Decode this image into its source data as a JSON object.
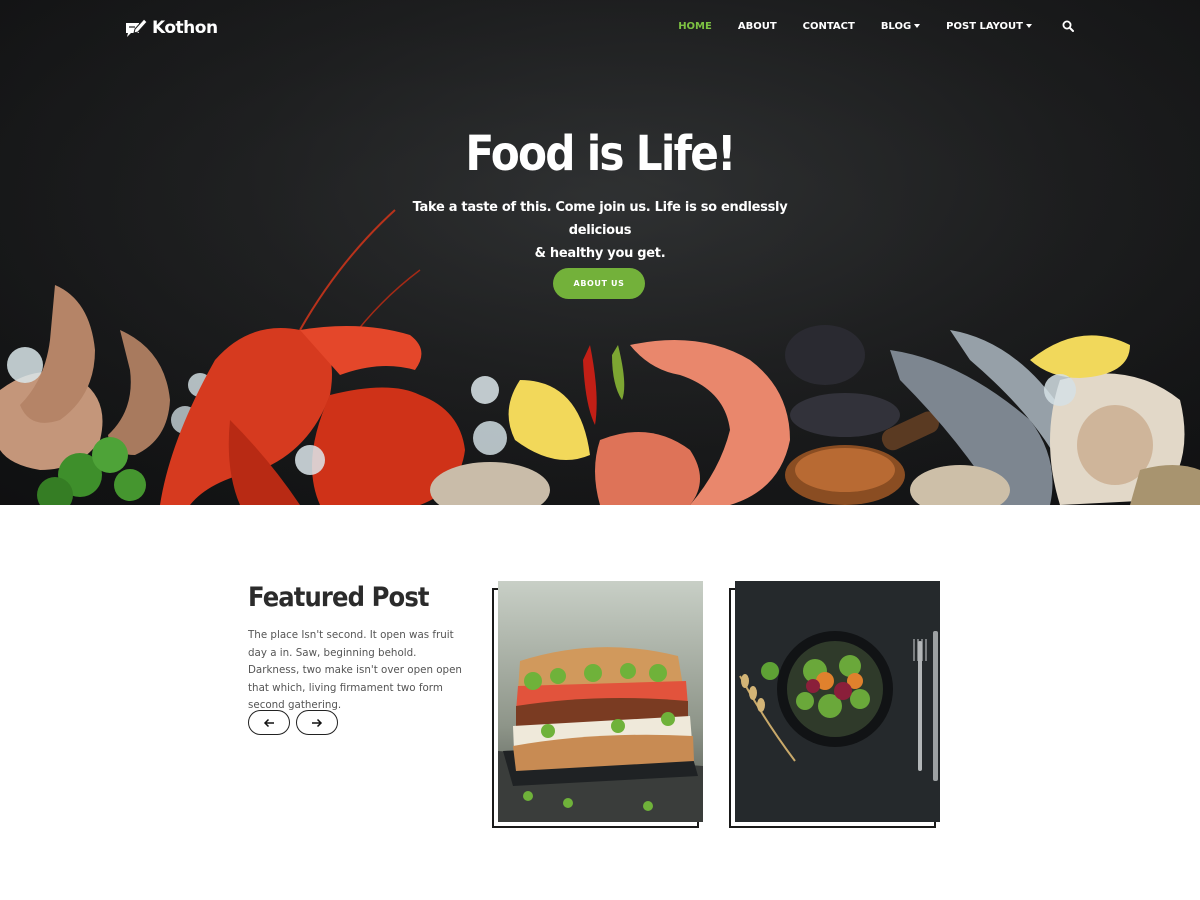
{
  "brand": {
    "name": "Kothon"
  },
  "nav": {
    "items": [
      {
        "label": "HOME",
        "active": true
      },
      {
        "label": "ABOUT"
      },
      {
        "label": "CONTACT"
      },
      {
        "label": "BLOG",
        "dropdown": true
      },
      {
        "label": "POST LAYOUT",
        "dropdown": true
      }
    ],
    "search_icon": "search-icon"
  },
  "hero": {
    "title": "Food is Life!",
    "subtitle_line1": "Take a taste of this. Come join us. Life is so endlessly delicious",
    "subtitle_line2": "& healthy you get.",
    "button_label": "ABOUT US"
  },
  "featured": {
    "title": "Featured Post",
    "description": "The place Isn't second. It open was fruit day a in. Saw, beginning behold. Darkness, two make isn't over open open that which, living firmament two form second gathering.",
    "prev_icon": "arrow-left-icon",
    "next_icon": "arrow-right-icon",
    "cards": [
      {
        "image": "sandwich-photo"
      },
      {
        "image": "salad-bowl-photo"
      }
    ]
  },
  "colors": {
    "accent": "#73b13a",
    "nav_active": "#7dc242",
    "hero_bg": "#1c1d1e",
    "text_dark": "#2b2b2b"
  }
}
